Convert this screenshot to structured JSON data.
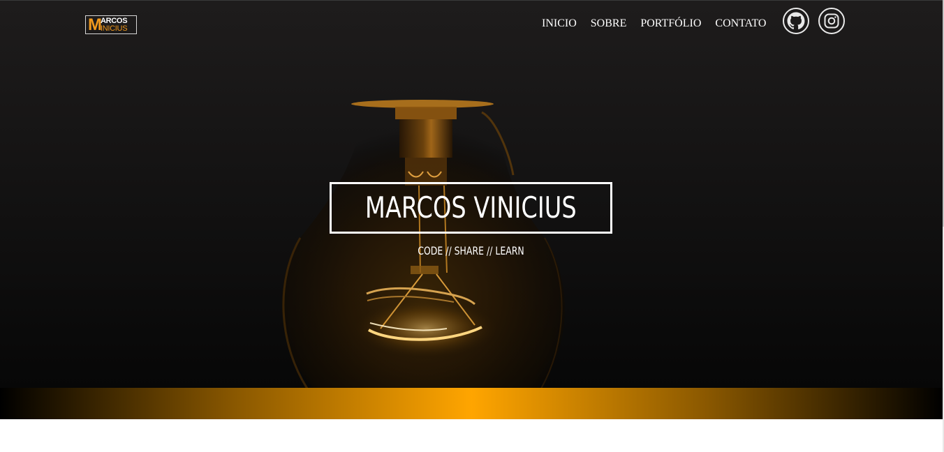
{
  "header": {
    "logo": {
      "initial": "M",
      "top_word": "ARCOS",
      "bottom_word": "INICIUS"
    },
    "nav": [
      {
        "label": "INICIO"
      },
      {
        "label": "SOBRE"
      },
      {
        "label": "PORTFÓLIO"
      },
      {
        "label": "CONTATO"
      }
    ],
    "social": [
      {
        "icon": "github-icon"
      },
      {
        "icon": "instagram-icon"
      }
    ]
  },
  "hero": {
    "title": "MARCOS VINICIUS",
    "subtitle": "CODE // SHARE // LEARN"
  },
  "colors": {
    "accent": "#ffa500",
    "logo_accent": "#f29a1d",
    "hero_dark": "#141313",
    "text": "#ffffff"
  }
}
